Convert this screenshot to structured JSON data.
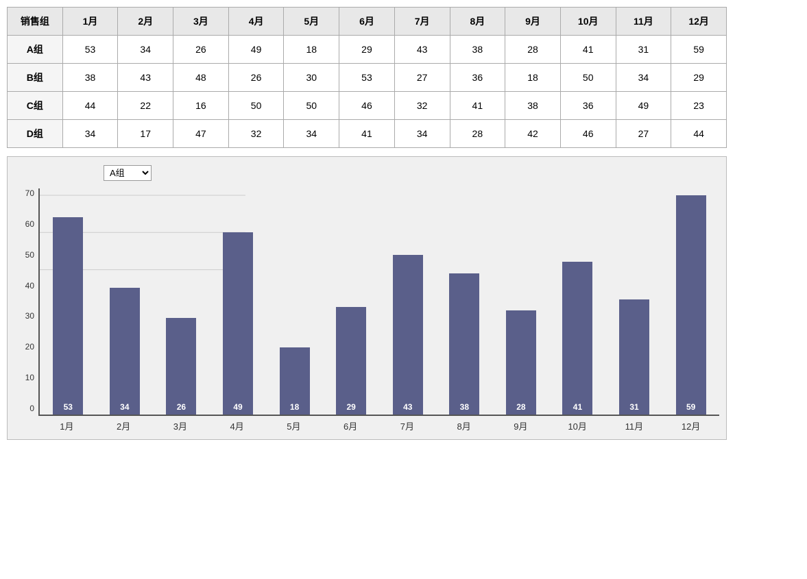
{
  "table": {
    "headers": [
      "销售组",
      "1月",
      "2月",
      "3月",
      "4月",
      "5月",
      "6月",
      "7月",
      "8月",
      "9月",
      "10月",
      "11月",
      "12月"
    ],
    "rows": [
      {
        "group": "A组",
        "values": [
          53,
          34,
          26,
          49,
          18,
          29,
          43,
          38,
          28,
          41,
          31,
          59
        ]
      },
      {
        "group": "B组",
        "values": [
          38,
          43,
          48,
          26,
          30,
          53,
          27,
          36,
          18,
          50,
          34,
          29
        ]
      },
      {
        "group": "C组",
        "values": [
          44,
          22,
          16,
          50,
          50,
          46,
          32,
          41,
          38,
          36,
          49,
          23
        ]
      },
      {
        "group": "D组",
        "values": [
          34,
          17,
          47,
          32,
          34,
          41,
          34,
          28,
          42,
          46,
          27,
          44
        ]
      }
    ]
  },
  "chart": {
    "selected_group": "A组",
    "y_axis_labels": [
      "70",
      "60",
      "50",
      "40",
      "30",
      "20",
      "10",
      "0"
    ],
    "x_axis_labels": [
      "1月",
      "2月",
      "3月",
      "4月",
      "5月",
      "6月",
      "7月",
      "8月",
      "9月",
      "10月",
      "11月",
      "12月"
    ],
    "current_data": [
      53,
      34,
      26,
      49,
      18,
      29,
      43,
      38,
      28,
      41,
      31,
      59
    ],
    "max_value": 70,
    "dropdown_options": [
      "A组",
      "B组",
      "C组",
      "D组"
    ],
    "dropdown_label": "A组"
  }
}
